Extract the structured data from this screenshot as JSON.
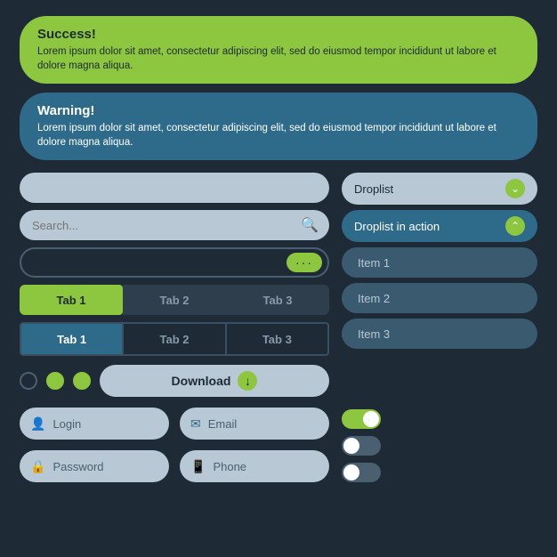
{
  "alerts": {
    "success": {
      "title": "Success!",
      "text": "Lorem ipsum dolor sit amet, consectetur adipiscing elit, sed do eiusmod tempor incididunt ut labore et dolore magna aliqua.",
      "bg": "#8dc63f"
    },
    "warning": {
      "title": "Warning!",
      "text": "Lorem ipsum dolor sit amet, consectetur adipiscing elit, sed do eiusmod tempor incididunt ut labore et dolore magna aliqua.",
      "bg": "#2e6b8a"
    }
  },
  "inputs": {
    "empty_placeholder": "",
    "search_placeholder": "Search...",
    "dots": "···"
  },
  "tabs_1": {
    "tab1": "Tab 1",
    "tab2": "Tab 2",
    "tab3": "Tab 3"
  },
  "tabs_2": {
    "tab1": "Tab 1",
    "tab2": "Tab 2",
    "tab3": "Tab 3"
  },
  "droplist": {
    "label": "Droplist",
    "active_label": "Droplist in action",
    "items": [
      "Item 1",
      "Item 2",
      "Item 3"
    ]
  },
  "download": {
    "label": "Download"
  },
  "form": {
    "login_placeholder": "Login",
    "password_placeholder": "Password",
    "email_placeholder": "Email",
    "phone_placeholder": "Phone"
  }
}
